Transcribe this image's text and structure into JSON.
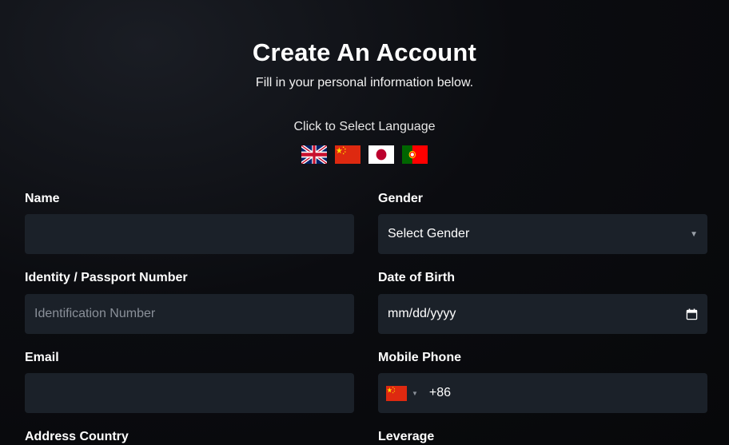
{
  "header": {
    "title": "Create An Account",
    "subtitle": "Fill in your personal information below.",
    "language_prompt": "Click to Select Language"
  },
  "languages": [
    {
      "icon": "uk-flag-icon"
    },
    {
      "icon": "china-flag-icon"
    },
    {
      "icon": "japan-flag-icon"
    },
    {
      "icon": "portugal-flag-icon"
    }
  ],
  "form": {
    "name": {
      "label": "Name",
      "value": ""
    },
    "gender": {
      "label": "Gender",
      "value": "Select Gender"
    },
    "identity": {
      "label": "Identity / Passport Number",
      "placeholder": "Identification Number",
      "value": ""
    },
    "dob": {
      "label": "Date of Birth",
      "value": "mm/dd/yyyy"
    },
    "email": {
      "label": "Email",
      "value": ""
    },
    "mobile": {
      "label": "Mobile Phone",
      "code": "+86",
      "flag": "china-flag-icon"
    },
    "address_country": {
      "label": "Address Country"
    },
    "leverage": {
      "label": "Leverage"
    }
  },
  "colors": {
    "background": "#0b0c10",
    "field_bg": "#1b2129",
    "text": "#ffffff",
    "placeholder": "#8a9099"
  }
}
